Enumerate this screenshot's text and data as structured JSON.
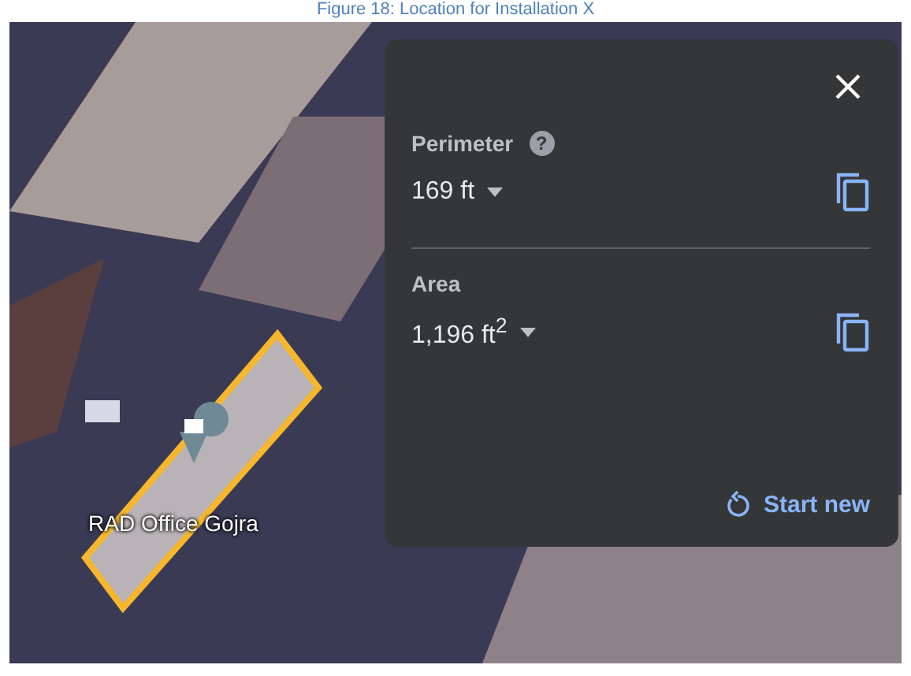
{
  "caption": "Figure 18: Location for Installation X",
  "map": {
    "place_label": "RAD Office Gojra"
  },
  "measure_panel": {
    "measurements": [
      {
        "label": "Perimeter",
        "value": "169 ft",
        "help": "?"
      },
      {
        "label": "Area",
        "value": "1,196 ft$^{2}$"
      }
    ],
    "start_new": "Start new"
  }
}
